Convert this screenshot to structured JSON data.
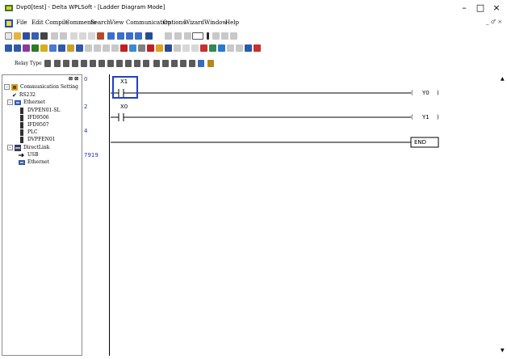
{
  "window": {
    "title": "Dvp0[test] - Delta WPLSoft - [Ladder Diagram Mode]",
    "minimize": "–",
    "maximize": "□",
    "close": "×"
  },
  "menu": {
    "items": [
      "File",
      "Edit",
      "Compile",
      "Comments",
      "Search",
      "View",
      "Communication",
      "Options",
      "Wizard",
      "Window",
      "Help"
    ],
    "mdi_controls": "_ ♂ ×"
  },
  "toolbar3": {
    "relay_type_label": "Relay Type"
  },
  "panel": {
    "header": "⊠ ⊠",
    "tree": [
      {
        "label": "Communication Setting",
        "level": 0,
        "expander": "-",
        "icon": "settings"
      },
      {
        "label": "RS232",
        "level": 1,
        "check": "✔"
      },
      {
        "label": "Ethernet",
        "level": 1,
        "expander": "-",
        "icon": "ethernet"
      },
      {
        "label": "DVPEN01-SL",
        "level": 2,
        "icon": "device"
      },
      {
        "label": "IFD9506",
        "level": 2,
        "icon": "device"
      },
      {
        "label": "IFD9507",
        "level": 2,
        "icon": "device"
      },
      {
        "label": "PLC",
        "level": 2,
        "icon": "device"
      },
      {
        "label": "DVPFEN01",
        "level": 2,
        "icon": "device"
      },
      {
        "label": "DirectLink",
        "level": 1,
        "expander": "-",
        "icon": "directlink"
      },
      {
        "label": "USB",
        "level": 2,
        "icon": "usb"
      },
      {
        "label": "Ethernet",
        "level": 2,
        "icon": "ethernet"
      }
    ]
  },
  "ladder": {
    "steps": [
      "0",
      "2",
      "4",
      "7919"
    ],
    "rungs": [
      {
        "contact": "X1",
        "coil": "Y0"
      },
      {
        "contact": "X0",
        "coil": "Y1"
      },
      {
        "end": "END"
      }
    ],
    "coil_open": "(",
    "coil_close": ")"
  },
  "scroll": {
    "up": "▲",
    "down": "▼"
  }
}
